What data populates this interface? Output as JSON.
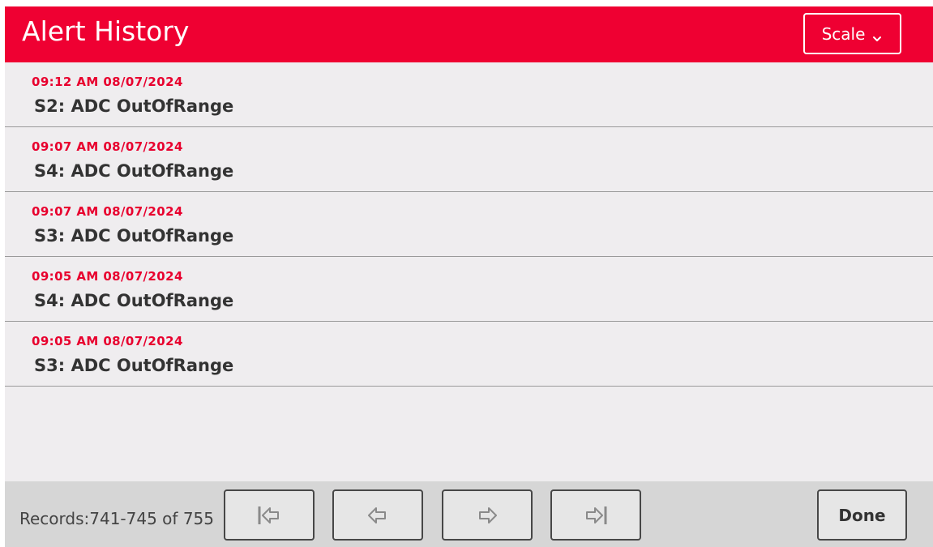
{
  "header": {
    "title": "Alert History",
    "scale_label": "Scale"
  },
  "alerts": [
    {
      "time": "09:12 AM 08/07/2024",
      "message": "S2: ADC OutOfRange"
    },
    {
      "time": "09:07 AM 08/07/2024",
      "message": "S4: ADC OutOfRange"
    },
    {
      "time": "09:07 AM 08/07/2024",
      "message": "S3: ADC OutOfRange"
    },
    {
      "time": "09:05 AM 08/07/2024",
      "message": "S4: ADC OutOfRange"
    },
    {
      "time": "09:05 AM 08/07/2024",
      "message": "S3: ADC OutOfRange"
    }
  ],
  "footer": {
    "records_text": "Records:741-745 of 755",
    "done_label": "Done",
    "nav_icons": [
      "first-page-icon",
      "previous-page-icon",
      "next-page-icon",
      "last-page-icon"
    ]
  },
  "colors": {
    "accent": "#ef0032",
    "time_text": "#e8002e",
    "background": "#efedef",
    "footer": "#d6d6d6"
  }
}
